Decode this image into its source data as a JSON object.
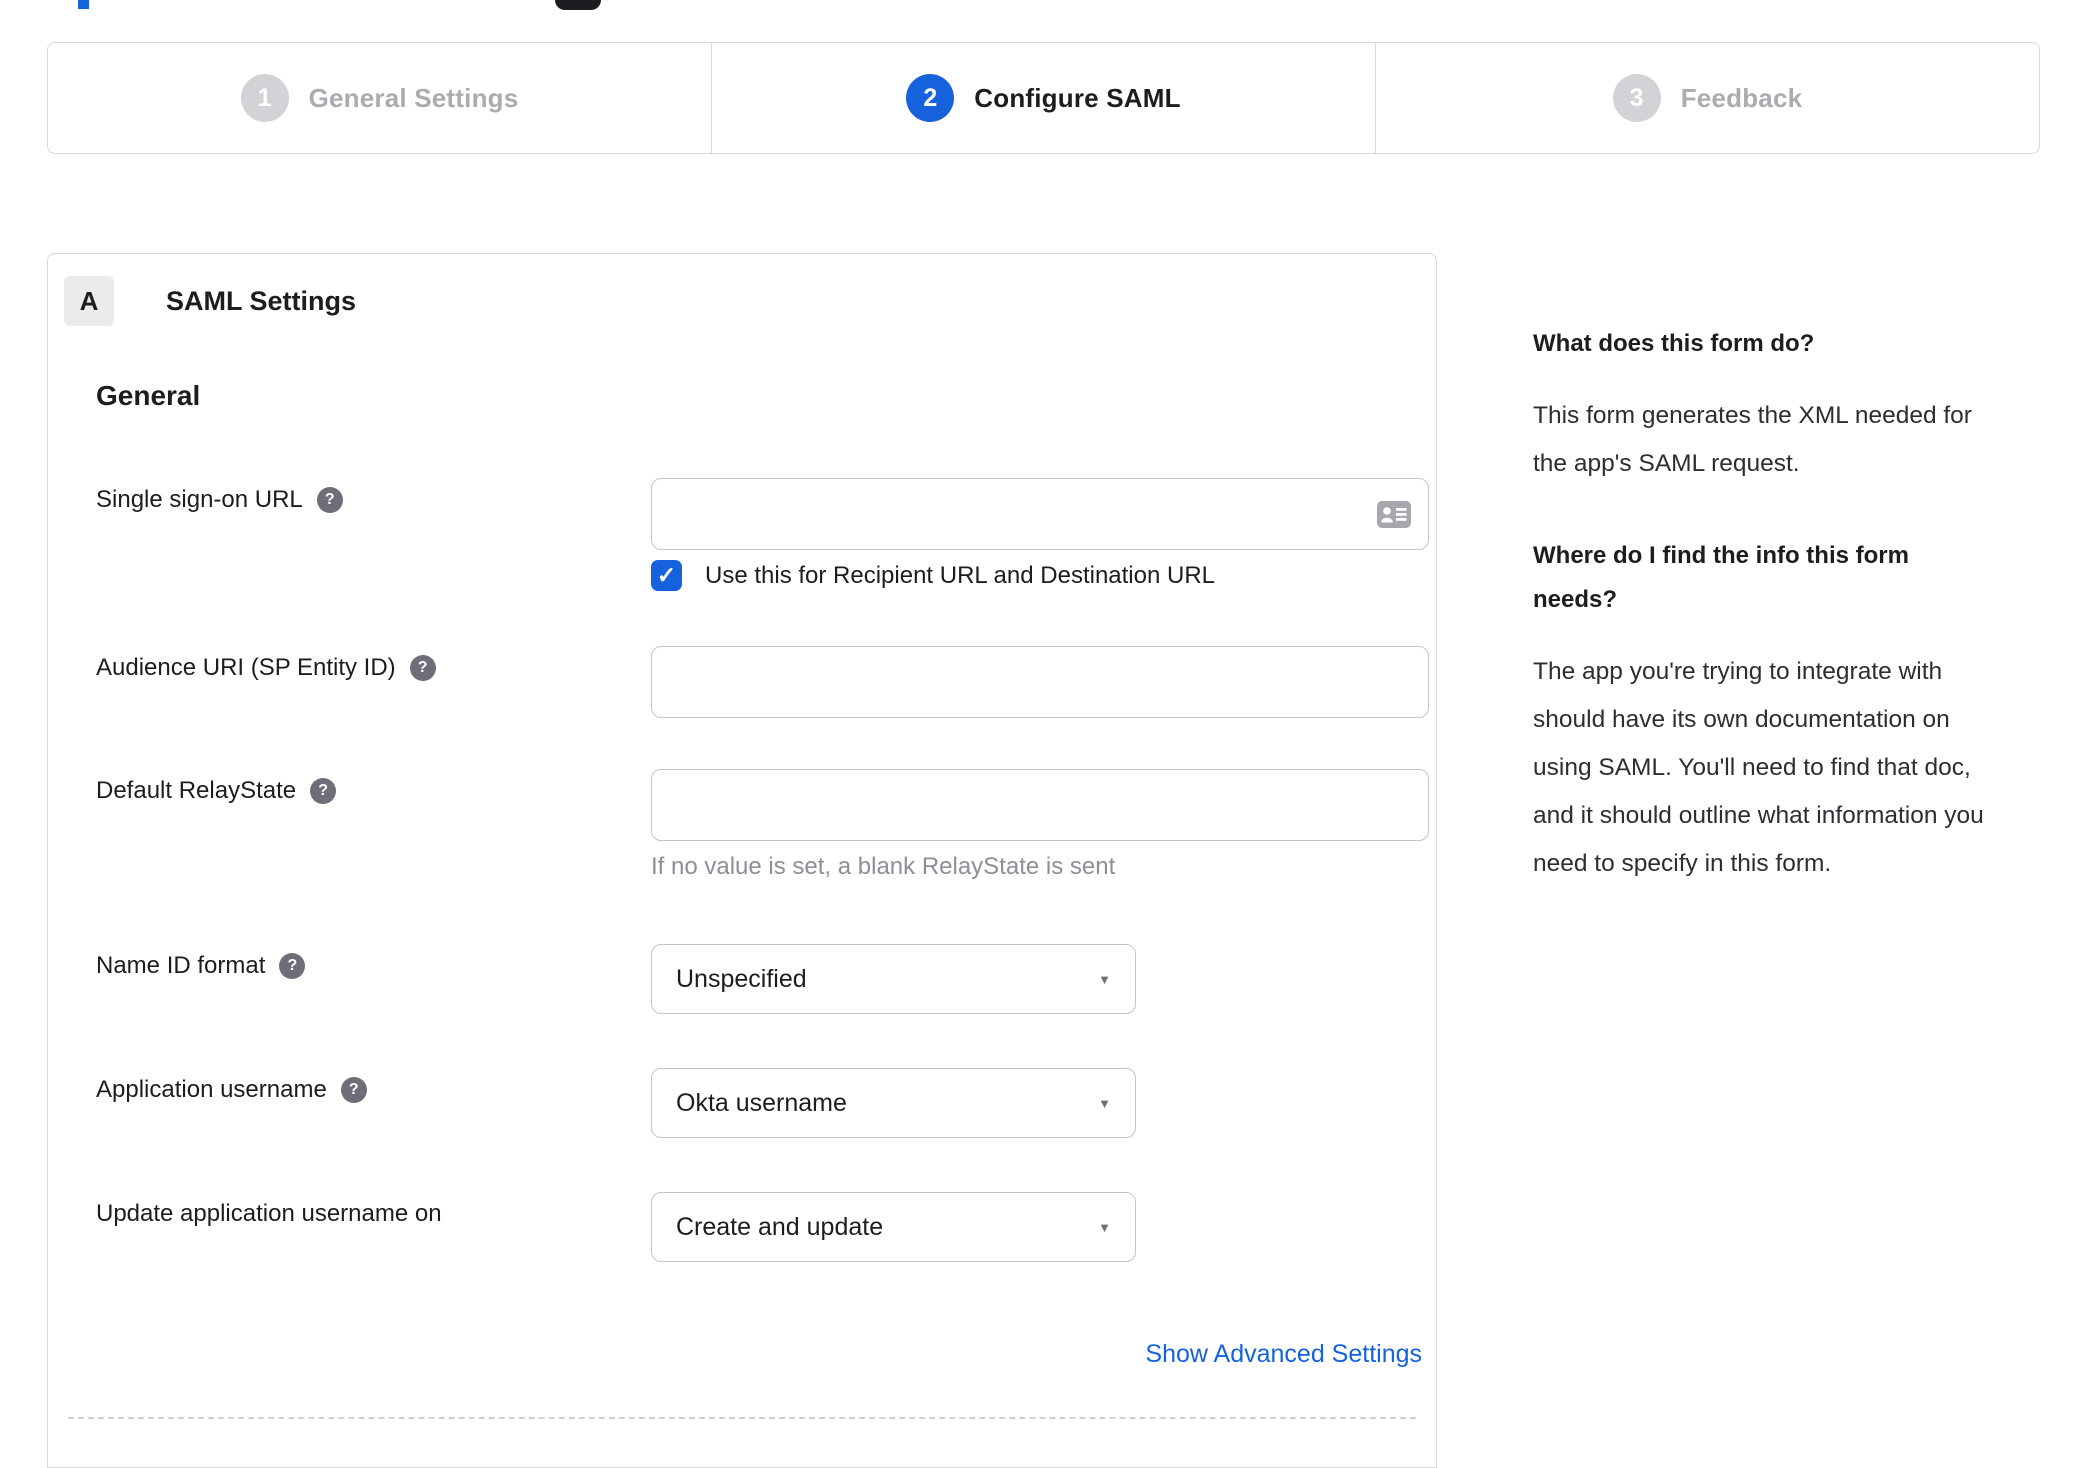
{
  "colors": {
    "accent_blue": "#1662dd",
    "dark_text": "#1d1d21",
    "inactive_step_gray": "#ababb1",
    "step_circle_gray": "#d3d3d7",
    "border_gray": "#d8d8dc",
    "input_border": "#c4c5ca",
    "help_icon_bg": "#6e6e78",
    "hint_gray": "#8e8e98",
    "badge_bg": "#ebebed"
  },
  "icons": {
    "help": "?",
    "check": "✓",
    "dropdown_arrow": "▼"
  },
  "stepper": {
    "steps": [
      {
        "number": "1",
        "label": "General Settings"
      },
      {
        "number": "2",
        "label": "Configure SAML"
      },
      {
        "number": "3",
        "label": "Feedback"
      }
    ]
  },
  "panel": {
    "badge": "A",
    "title": "SAML Settings",
    "section_heading": "General",
    "sso": {
      "label": "Single sign-on URL",
      "value": "",
      "checkbox_label": "Use this for Recipient URL and Destination URL",
      "checked": true
    },
    "audience": {
      "label": "Audience URI (SP Entity ID)",
      "value": ""
    },
    "relay": {
      "label": "Default RelayState",
      "value": "",
      "hint": "If no value is set, a blank RelayState is sent"
    },
    "name_id": {
      "label": "Name ID format",
      "value": "Unspecified"
    },
    "app_username": {
      "label": "Application username",
      "value": "Okta username"
    },
    "update_username": {
      "label": "Update application username on",
      "value": "Create and update"
    },
    "advanced_link": "Show Advanced Settings"
  },
  "sidebar": {
    "q1": "What does this form do?",
    "a1": "This form generates the XML needed for the app's SAML request.",
    "q2": "Where do I find the info this form needs?",
    "a2": "The app you're trying to integrate with should have its own documentation on using SAML. You'll need to find that doc, and it should outline what information you need to specify in this form."
  }
}
